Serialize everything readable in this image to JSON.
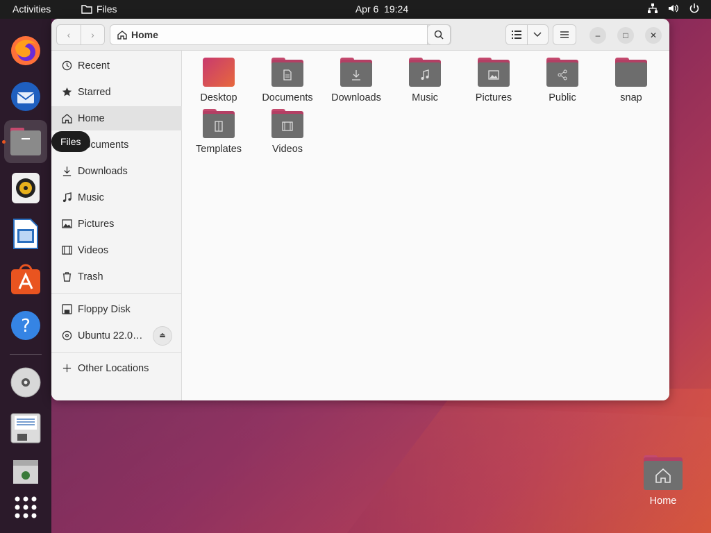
{
  "topbar": {
    "activities": "Activities",
    "app_name": "Files",
    "date": "Apr 6",
    "time": "19:24"
  },
  "dock": {
    "tooltip": "Files",
    "apps": [
      "firefox-icon",
      "thunderbird-icon",
      "files-icon",
      "rhythmbox-icon",
      "libreoffice-writer-icon",
      "app-center-icon",
      "help-icon",
      "cd-drive-icon",
      "floppy-icon",
      "trash-drive-icon",
      "show-apps-icon"
    ]
  },
  "headerbar": {
    "path": "Home"
  },
  "sidebar": {
    "items": [
      {
        "label": "Recent",
        "icon": "clock-icon"
      },
      {
        "label": "Starred",
        "icon": "star-icon"
      },
      {
        "label": "Home",
        "icon": "home-icon"
      },
      {
        "label": "Documents",
        "icon": "document-icon"
      },
      {
        "label": "Downloads",
        "icon": "download-icon"
      },
      {
        "label": "Music",
        "icon": "music-icon"
      },
      {
        "label": "Pictures",
        "icon": "picture-icon"
      },
      {
        "label": "Videos",
        "icon": "video-icon"
      },
      {
        "label": "Trash",
        "icon": "trash-icon"
      }
    ],
    "devices": [
      {
        "label": "Floppy Disk",
        "icon": "floppy-icon"
      },
      {
        "label": "Ubuntu 22.0…",
        "icon": "disc-icon"
      }
    ],
    "other": {
      "label": "Other Locations",
      "icon": "plus-icon"
    }
  },
  "files": [
    {
      "label": "Desktop",
      "icon": "desktop-folder-icon"
    },
    {
      "label": "Documents",
      "icon": "documents-folder-icon"
    },
    {
      "label": "Downloads",
      "icon": "downloads-folder-icon"
    },
    {
      "label": "Music",
      "icon": "music-folder-icon"
    },
    {
      "label": "Pictures",
      "icon": "pictures-folder-icon"
    },
    {
      "label": "Public",
      "icon": "public-folder-icon"
    },
    {
      "label": "snap",
      "icon": "folder-icon"
    },
    {
      "label": "Templates",
      "icon": "templates-folder-icon"
    },
    {
      "label": "Videos",
      "icon": "videos-folder-icon"
    }
  ],
  "desktop": {
    "home_label": "Home"
  },
  "colors": {
    "accent": "#e95420",
    "folder_tab": "#c44a6e",
    "folder_body": "#6d6d6d"
  }
}
